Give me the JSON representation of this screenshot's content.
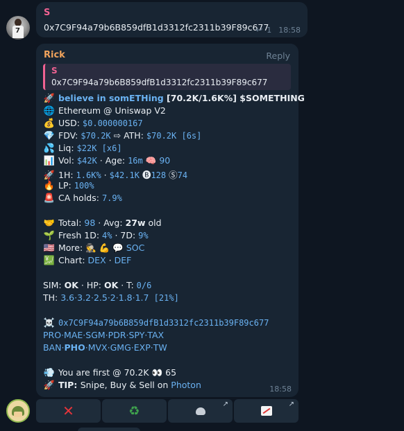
{
  "msg1": {
    "sender": "S",
    "text": "0x7C9F94a79b6B859dfB1d3312fc2311b39F89c677",
    "reply_count": "1",
    "time": "18:58"
  },
  "msg2": {
    "sender": "Rick",
    "reply_label": "Reply",
    "quote_sender": "S",
    "quote_text": "0x7C9F94a79b6B859dfB1d3312fc2311b39F89c677",
    "time": "18:58",
    "line1": {
      "emoji": "🚀",
      "name": "believe in somETHing",
      "stats": " [70.2K/1.6K%] ",
      "ticker": "$SOMETHING"
    },
    "line2": {
      "emoji": "🌐",
      "text": "Ethereum @ Uniswap V2"
    },
    "line3": {
      "emoji": "💰",
      "label": "USD: ",
      "value": "$0.000000167"
    },
    "line4": {
      "emoji": "💎",
      "label": "FDV: ",
      "fdv": "$70.2K",
      "mid": " ⇨ ATH: ",
      "ath": "$70.2K [6s]"
    },
    "line5": {
      "emoji": "💦",
      "label": "Liq: ",
      "value": "$22K [x6]"
    },
    "line6": {
      "emoji": "📊",
      "label": "Vol: ",
      "vol": "$42K",
      "mid": " · Age: ",
      "age": "16m",
      "brain": "🧠",
      "brain_val": "90"
    },
    "line7": {
      "emoji": "🚀",
      "label": "1H: ",
      "pct": "1.6K%",
      "sep": " · ",
      "amt": "$42.1K",
      "b_icon": "🅑",
      "b_val": "128",
      "s_icon": "Ⓢ",
      "s_val": "74"
    },
    "line8": {
      "emoji": "🔥",
      "label": "LP: ",
      "value": "100%"
    },
    "line9": {
      "emoji": "🚨",
      "label": "CA holds: ",
      "value": "7.9%"
    },
    "line10": {
      "emoji": "🤝",
      "label": "Total: ",
      "total": "98",
      "mid": " · Avg: ",
      "avg": "27w",
      "suffix": " old"
    },
    "line11": {
      "emoji": "🌱",
      "label": "Fresh 1D: ",
      "d1": "4%",
      "mid": " · 7D: ",
      "d7": "9%"
    },
    "line12": {
      "emoji": "🇺🇸",
      "label": "More: ",
      "e1": "🕵",
      "e2": "💪",
      "e3": "💬",
      "soc": "SOC"
    },
    "line13": {
      "emoji": "💹",
      "label": "Chart: ",
      "dex": "DEX",
      "sep": " · ",
      "def": "DEF"
    },
    "line14": {
      "sim_label": "SIM: ",
      "sim": "OK",
      "hp_label": " · HP: ",
      "hp": "OK",
      "t_label": " · T: ",
      "t": "0/6"
    },
    "line15": {
      "label": "TH: ",
      "value": "3.6·3.2·2.5·2·1.8·1.7",
      "pct": " [21%]"
    },
    "line16": {
      "emoji": "☠️",
      "value": "0x7C9F94a79b6B859dfB1d3312fc2311b39F89c677"
    },
    "line17": {
      "links": [
        "PRO",
        "MAE",
        "SGM",
        "PDR",
        "SPY",
        "TAX"
      ]
    },
    "line18": {
      "links": [
        "BAN",
        "PHO",
        "MVX",
        "GMG",
        "EXP",
        "TW"
      ]
    },
    "line19": {
      "emoji": "💨",
      "text": "You are first @ 70.2K",
      "eyes": "👀",
      "count": " 65"
    },
    "line20": {
      "emoji": "🚀",
      "label": "TIP: ",
      "text": "Snipe, Buy & Sell on ",
      "photon": "Photon"
    }
  },
  "keyboard": {
    "btn1_icon": "✕",
    "btn2_icon": "♻",
    "btn3_arrow": "↗",
    "btn4_arrow": "↗"
  },
  "colors": {
    "bg": "#0e1621",
    "bubble": "#182533",
    "link": "#6ab2f2",
    "sender_s": "#f06292",
    "sender_rick": "#f0a35c"
  }
}
